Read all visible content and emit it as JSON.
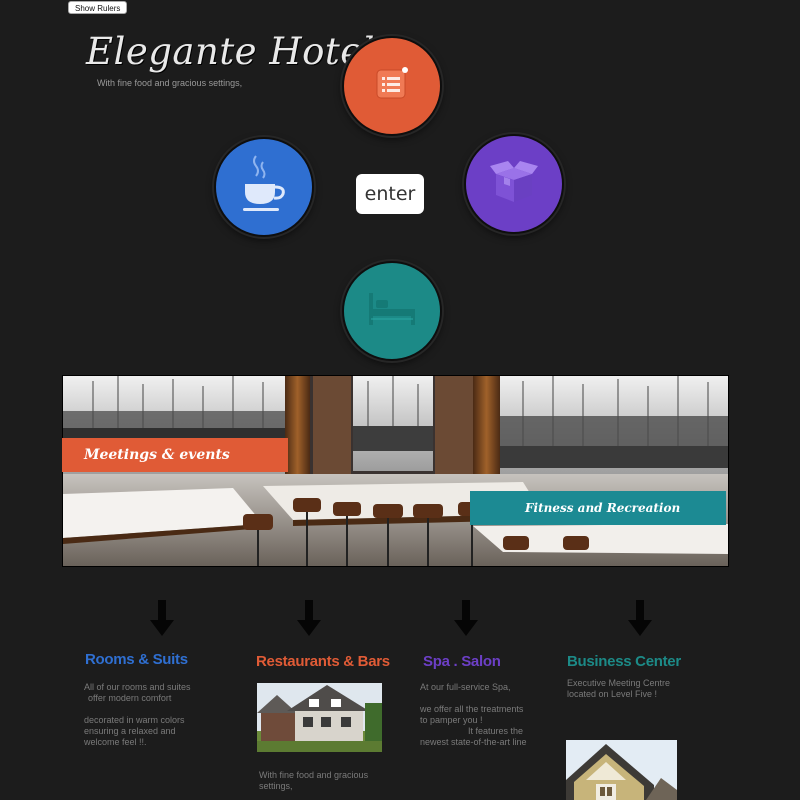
{
  "toolbar": {
    "show_rulers_label": "Show Rulers"
  },
  "header": {
    "logo": "Elegante Hotels",
    "tagline": "With fine food and gracious settings,"
  },
  "nav": {
    "enter_label": "enter",
    "circles": [
      {
        "icon": "menu-list-icon",
        "color": "#e05b36"
      },
      {
        "icon": "coffee-cup-icon",
        "color": "#2f6fd1"
      },
      {
        "icon": "gift-box-icon",
        "color": "#6c3fc6"
      },
      {
        "icon": "bed-icon",
        "color": "#1c8a87"
      }
    ]
  },
  "banner": {
    "meetings_label": "Meetings & events",
    "fitness_label": "Fitness and Recreation",
    "meetings_color": "#e05b36",
    "fitness_color": "#1c8a93"
  },
  "sections": {
    "rooms": {
      "title": "Rooms & Suits",
      "color": "#2f6fd1",
      "text1": "All of our rooms and suites",
      "text2": "offer modern comfort",
      "text3": "decorated in warm colors",
      "text4": "ensuring a relaxed and",
      "text5": "welcome feel !!."
    },
    "restaurants": {
      "title": "Restaurants & Bars",
      "color": "#e05b36",
      "text1": "With fine food and gracious",
      "text2": "settings,"
    },
    "spa": {
      "title": "Spa  . Salon",
      "color": "#6c3fc6",
      "text1": "At our full-service Spa,",
      "text2": "we offer all the treatments",
      "text3": "to pamper you !",
      "text4": "It features the",
      "text5": "newest state-of-the-art line"
    },
    "business": {
      "title": "Business Center",
      "color": "#1c8a87",
      "text1": "Executive Meeting Centre",
      "text2": "located on Level Five !"
    }
  }
}
